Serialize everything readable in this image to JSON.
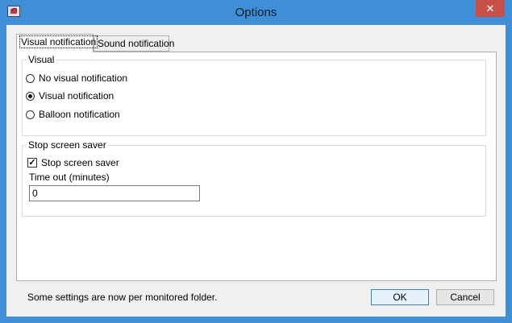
{
  "window": {
    "title": "Options",
    "close_glyph": "✕",
    "app_icon": "options-app-icon"
  },
  "tabs": [
    {
      "label": "Visual notification",
      "active": true
    },
    {
      "label": "Sound notification",
      "active": false
    }
  ],
  "visual_group": {
    "legend": "Visual",
    "options": [
      {
        "label": "No visual notification",
        "checked": false
      },
      {
        "label": "Visual notification",
        "checked": true
      },
      {
        "label": "Balloon notification",
        "checked": false
      }
    ]
  },
  "screensaver_group": {
    "legend": "Stop screen saver",
    "checkbox_label": "Stop screen saver",
    "checkbox_checked": true,
    "checkbox_glyph": "✓",
    "timeout_label": "Time out (minutes)",
    "timeout_value": "0"
  },
  "footer": {
    "note": "Some settings are now per monitored folder.",
    "ok_label": "OK",
    "cancel_label": "Cancel"
  }
}
